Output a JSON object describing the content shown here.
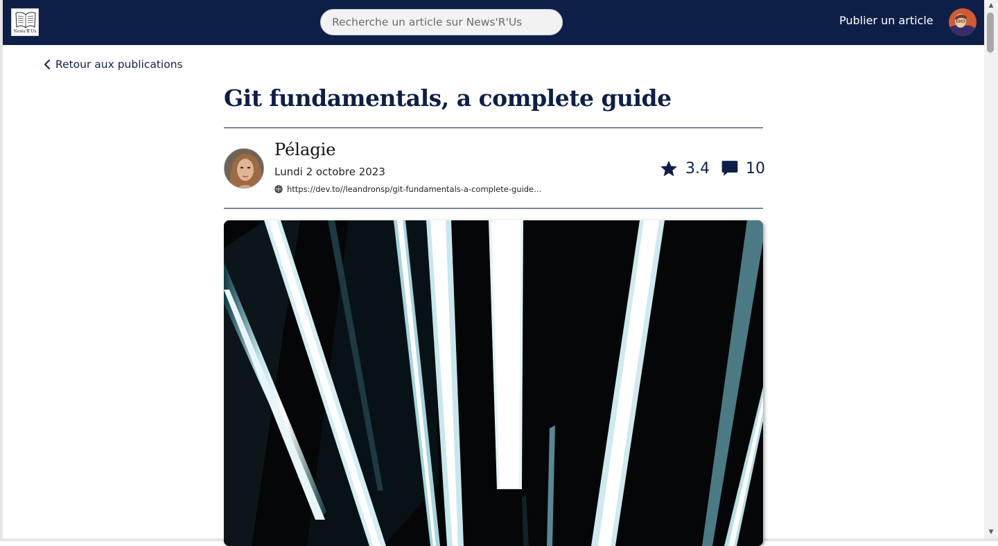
{
  "header": {
    "logo_text": "News'R'Us",
    "search_placeholder": "Recherche un article sur News'R'Us",
    "publish_label": "Publier un article"
  },
  "back_link": {
    "label": "Retour aux publications"
  },
  "article": {
    "title": "Git fundamentals, a complete guide",
    "author": "Pélagie",
    "date": "Lundi 2 octobre 2023",
    "source_url": "https://dev.to//leandronsp/git-fundamentals-a-complete-guide...",
    "rating": "3.4",
    "comments": "10"
  },
  "colors": {
    "navy": "#0e1f47",
    "white": "#ffffff"
  },
  "icons": {
    "back": "chevron-left-icon",
    "globe": "globe-icon",
    "star": "star-icon",
    "comment": "comment-icon"
  }
}
